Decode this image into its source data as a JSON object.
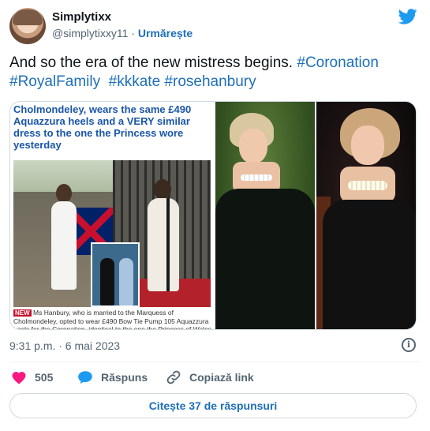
{
  "header": {
    "display_name": "Simplytixx",
    "handle": "@simplytixxy11",
    "separator": "·",
    "follow_label": "Urmărește"
  },
  "tweet": {
    "text_plain": "And so the era of the new mistress begins.",
    "hashtags": [
      "#Coronation",
      "#RoyalFamily",
      "#kkkate",
      "#rosehanbury"
    ]
  },
  "media": {
    "clipping": {
      "headline": "Cholmondeley, wears the same £490 Aquazzura heels and a VERY similar dress to the one the Princess wore yesterday",
      "badge": "NEW",
      "caption": "Ms Hanbury, who is married to the Marquess of Cholmondeley, opted to wear £490 Bow Tie Pump 105 Aquazzura heels for the Coronation, identical to the one the Princess of Wales"
    }
  },
  "meta": {
    "timestamp": "9:31 p.m. · 6 mai 2023",
    "info_glyph": "i"
  },
  "actions": {
    "like_count": "505",
    "reply_label": "Răspuns",
    "copy_link_label": "Copiază link"
  },
  "read_replies_label": "Citește 37 de răspunsuri",
  "colors": {
    "link": "#1d6fb8",
    "twitter_blue": "#1d9bf0",
    "heart": "#f91880",
    "muted": "#536471"
  }
}
